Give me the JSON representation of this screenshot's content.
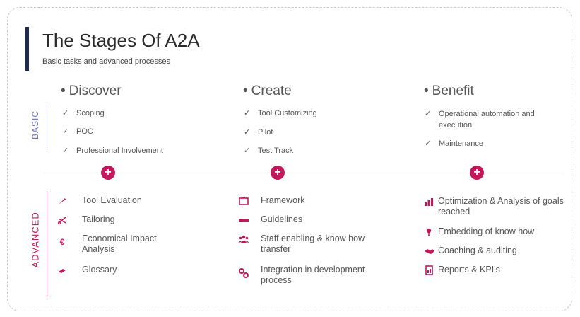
{
  "header": {
    "title": "The Stages Of A2A",
    "subtitle": "Basic tasks and advanced processes"
  },
  "labels": {
    "basic": "BASIC",
    "advanced": "ADVANCED"
  },
  "columns": [
    {
      "heading": "Discover",
      "basic": [
        "Scoping",
        "POC",
        "Professional Involvement"
      ],
      "advanced": [
        {
          "icon": "wrench-icon",
          "text": "Tool Evaluation"
        },
        {
          "icon": "scissors-icon",
          "text": "Tailoring"
        },
        {
          "icon": "euro-icon",
          "text": "Economical Impact Analysis"
        },
        {
          "icon": "eraser-icon",
          "text": "Glossary"
        }
      ]
    },
    {
      "heading": "Create",
      "basic": [
        "Tool Customizing",
        "Pilot",
        "Test Track"
      ],
      "advanced": [
        {
          "icon": "frame-icon",
          "text": "Framework"
        },
        {
          "icon": "minus-bar-icon",
          "text": "Guidelines"
        },
        {
          "icon": "users-icon",
          "text": "Staff enabling & know how transfer"
        },
        {
          "icon": "cogs-icon",
          "text": "Integration in development process"
        }
      ]
    },
    {
      "heading": "Benefit",
      "basic": [
        "Operational automation and execution",
        "Maintenance"
      ],
      "advanced": [
        {
          "icon": "bar-chart-icon",
          "text": "Optimization & Analysis of goals reached"
        },
        {
          "icon": "pin-icon",
          "text": "Embedding of know how"
        },
        {
          "icon": "handshake-icon",
          "text": "Coaching & auditing"
        },
        {
          "icon": "report-icon",
          "text": "Reports & KPI's"
        }
      ]
    }
  ],
  "bullet": "•",
  "check": "✓",
  "plus": "+",
  "colors": {
    "accent": "#c2185b",
    "basic": "#6a6fc0",
    "title_bar": "#1f2a4d"
  }
}
